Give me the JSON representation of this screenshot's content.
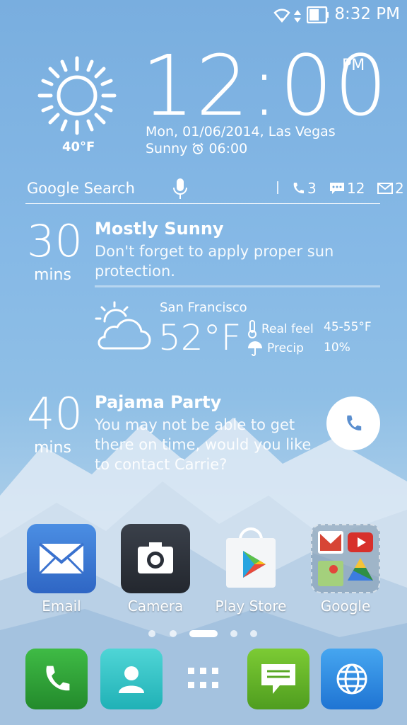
{
  "status_bar": {
    "time": "8:32 PM"
  },
  "clock": {
    "time": "12:00",
    "ampm": "PM",
    "date_location": "Mon, 01/06/2014, Las Vegas",
    "condition": "Sunny",
    "alarm": "06:00",
    "temperature": "40°F",
    "weather_icon": "sun-icon"
  },
  "search": {
    "label": "Google Search",
    "calls": "3",
    "messages": "12",
    "emails": "2"
  },
  "event1": {
    "minutes": "30",
    "unit": "mins",
    "title": "Mostly Sunny",
    "text": "Don't forget to apply proper sun protection."
  },
  "weather_detail": {
    "city": "San Francisco",
    "temperature": "52°F",
    "real_feel_label": "Real feel",
    "real_feel_value": "45-55°F",
    "precip_label": "Precip",
    "precip_value": "10%"
  },
  "event2": {
    "minutes": "40",
    "unit": "mins",
    "title": "Pajama Party",
    "text": "You may not be able to get there on time, would you like to contact Carrie?"
  },
  "apps": [
    {
      "label": "Email",
      "icon": "envelope-icon",
      "color": "#3b7bd8"
    },
    {
      "label": "Camera",
      "icon": "camera-icon",
      "color": "#2a2f38"
    },
    {
      "label": "Play Store",
      "icon": "play-store-icon",
      "color": "#ffffff"
    },
    {
      "label": "Google",
      "icon": "folder-icon",
      "color": "#8fa6bd"
    }
  ],
  "page_indicator": {
    "pages": 5,
    "active": 3
  },
  "dock": [
    {
      "icon": "phone-icon",
      "color": "#2ea43a"
    },
    {
      "icon": "contacts-icon",
      "color": "#2ec7c9"
    },
    {
      "icon": "app-drawer-icon",
      "color": "transparent"
    },
    {
      "icon": "messaging-icon",
      "color": "#6bbf2a"
    },
    {
      "icon": "browser-icon",
      "color": "#2d8ee6"
    }
  ]
}
